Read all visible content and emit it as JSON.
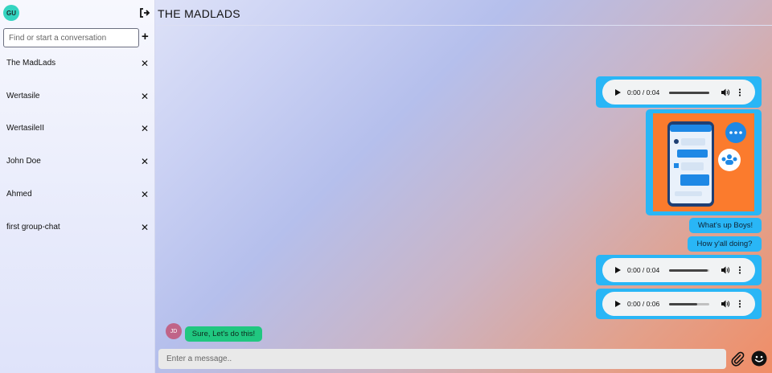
{
  "user": {
    "initials": "GU",
    "avatar_color": "#34d4c0"
  },
  "sidebar": {
    "search_placeholder": "Find or start a conversation",
    "conversations": [
      {
        "label": "The MadLads"
      },
      {
        "label": "Wertasile"
      },
      {
        "label": "WertasileII"
      },
      {
        "label": "John Doe"
      },
      {
        "label": "Ahmed"
      },
      {
        "label": "first group-chat"
      }
    ]
  },
  "chat": {
    "title": "THE MADLADS",
    "messages": [
      {
        "type": "audio",
        "time": "0:00 / 0:04",
        "progress": 1.0
      },
      {
        "type": "image",
        "alt": "phone chat illustration"
      },
      {
        "type": "text",
        "text": "What's up Boys!"
      },
      {
        "type": "text",
        "text": "How y'all doing?"
      },
      {
        "type": "audio",
        "time": "0:00 / 0:04",
        "progress": 0.95
      },
      {
        "type": "audio",
        "time": "0:00 / 0:06",
        "progress": 0.7
      }
    ],
    "incoming": {
      "sender_initials": "JD",
      "text": "Sure, Let's do this!",
      "avatar_color": "#c06488"
    },
    "input_placeholder": "Enter a message.."
  },
  "colors": {
    "outgoing_bubble": "#29b6f6",
    "incoming_bubble": "#20c780",
    "image_bg": "#fb7b2d"
  },
  "icons": [
    "logout-icon",
    "add-icon",
    "close-icon",
    "play-icon",
    "volume-icon",
    "more-vert-icon",
    "paperclip-icon",
    "emoji-icon"
  ]
}
